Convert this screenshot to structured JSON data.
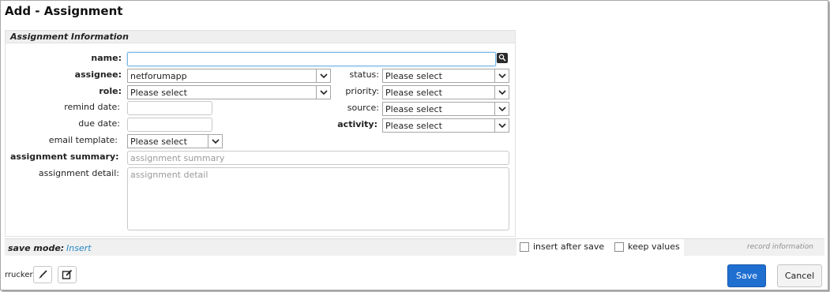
{
  "title": "Add - Assignment",
  "section": {
    "header": "Assignment Information"
  },
  "form": {
    "name_label": "name:",
    "assignee_label": "assignee:",
    "assignee_value": "netforumapp",
    "role_label": "role:",
    "role_value": "Please select",
    "remind_date_label": "remind date:",
    "due_date_label": "due date:",
    "email_template_label": "email template:",
    "email_template_value": "Please select",
    "summary_label": "assignment summary:",
    "summary_placeholder": "assignment summary",
    "detail_label": "assignment detail:",
    "detail_placeholder": "assignment detail",
    "status_label": "status:",
    "status_value": "Please select",
    "priority_label": "priority:",
    "priority_value": "Please select",
    "source_label": "source:",
    "source_value": "Please select",
    "activity_label": "activity:",
    "activity_value": "Please select"
  },
  "save_bar": {
    "save_mode_label": "save mode:",
    "save_mode_value": "Insert",
    "insert_after_save_label": "insert after save",
    "keep_values_label": "keep values",
    "record_information": "record information"
  },
  "footer": {
    "username": "rrucker",
    "save_label": "Save",
    "cancel_label": "Cancel"
  },
  "icons": [
    "search-icon",
    "chevron-down-icon",
    "brush-icon",
    "edit-icon"
  ],
  "colors": {
    "primary_button": "#1f6fd1",
    "link": "#2a8ac4"
  }
}
